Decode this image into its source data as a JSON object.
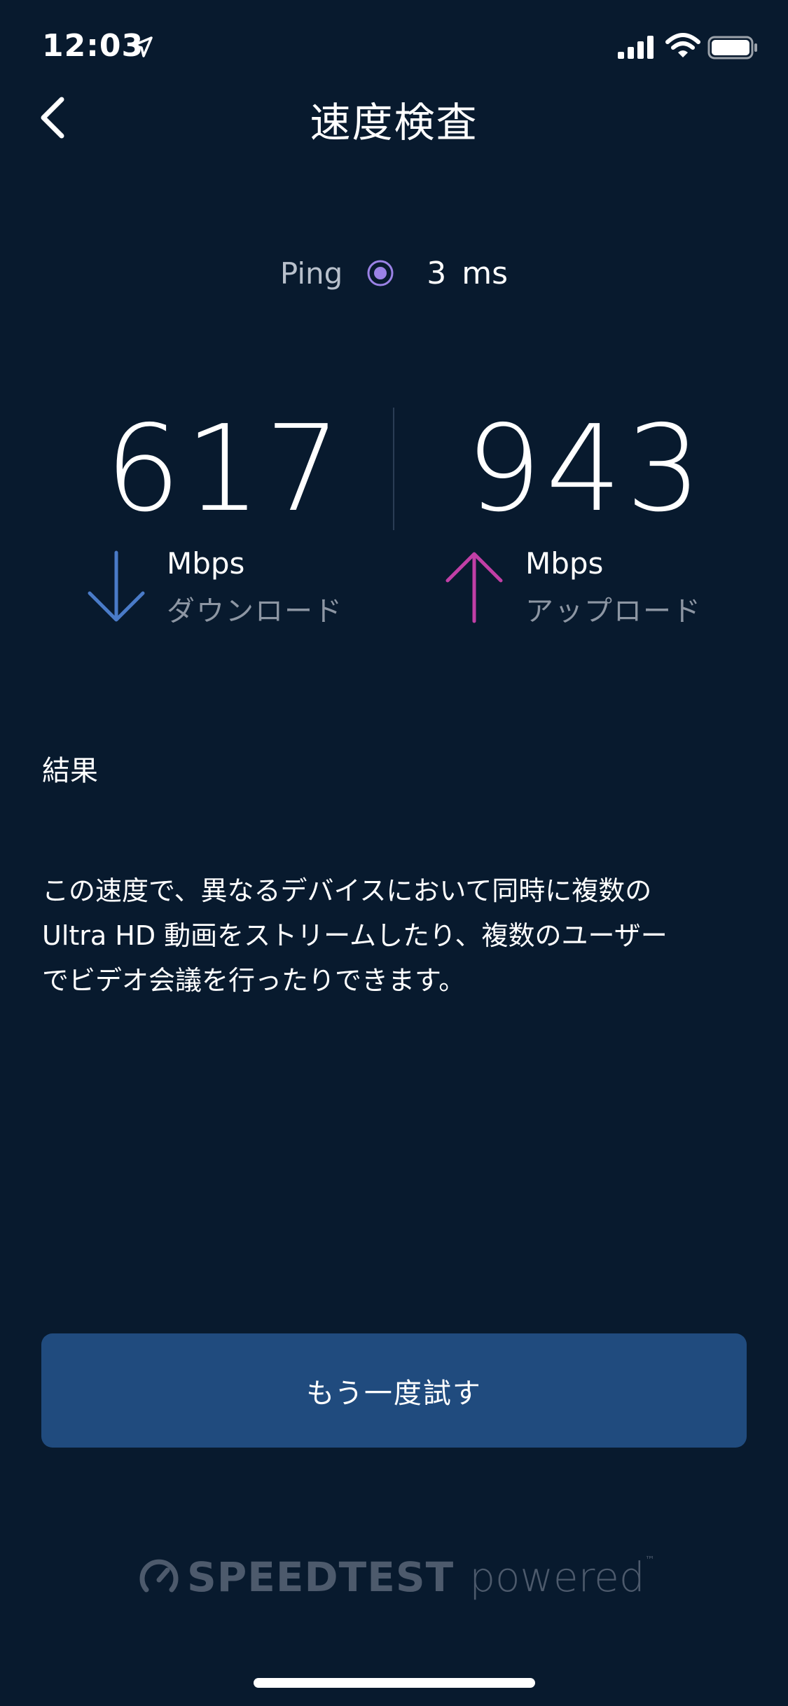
{
  "status_bar": {
    "time": "12:03"
  },
  "header": {
    "title": "速度検査"
  },
  "ping": {
    "label": "Ping",
    "value": "3",
    "unit": "ms"
  },
  "download": {
    "value": "617",
    "unit": "Mbps",
    "label": "ダウンロード",
    "color": "#4a7bc8"
  },
  "upload": {
    "value": "943",
    "unit": "Mbps",
    "label": "アップロード",
    "color": "#c13fa6"
  },
  "result": {
    "heading": "結果",
    "lines": [
      "この速度で、異なるデバイスにおいて同時に複数の",
      "Ultra HD 動画をストリームしたり、複数のユーザー",
      "でビデオ会議を行ったりできます。"
    ]
  },
  "retry_button": {
    "label": "もう一度試す"
  },
  "branding": {
    "strong": "SPEEDTEST",
    "light": "powered",
    "tm": "™"
  },
  "icons": {
    "back": "chevron-left-icon",
    "location": "location-arrow-icon",
    "signal": "cellular-signal-icon",
    "wifi": "wifi-icon",
    "battery": "battery-icon",
    "ping": "radio-dot-icon",
    "download": "arrow-down-icon",
    "upload": "arrow-up-icon",
    "gauge": "speedometer-icon"
  },
  "colors": {
    "background": "#081a2e",
    "button": "#204b7e",
    "ping_dot": "#9b82e6"
  }
}
